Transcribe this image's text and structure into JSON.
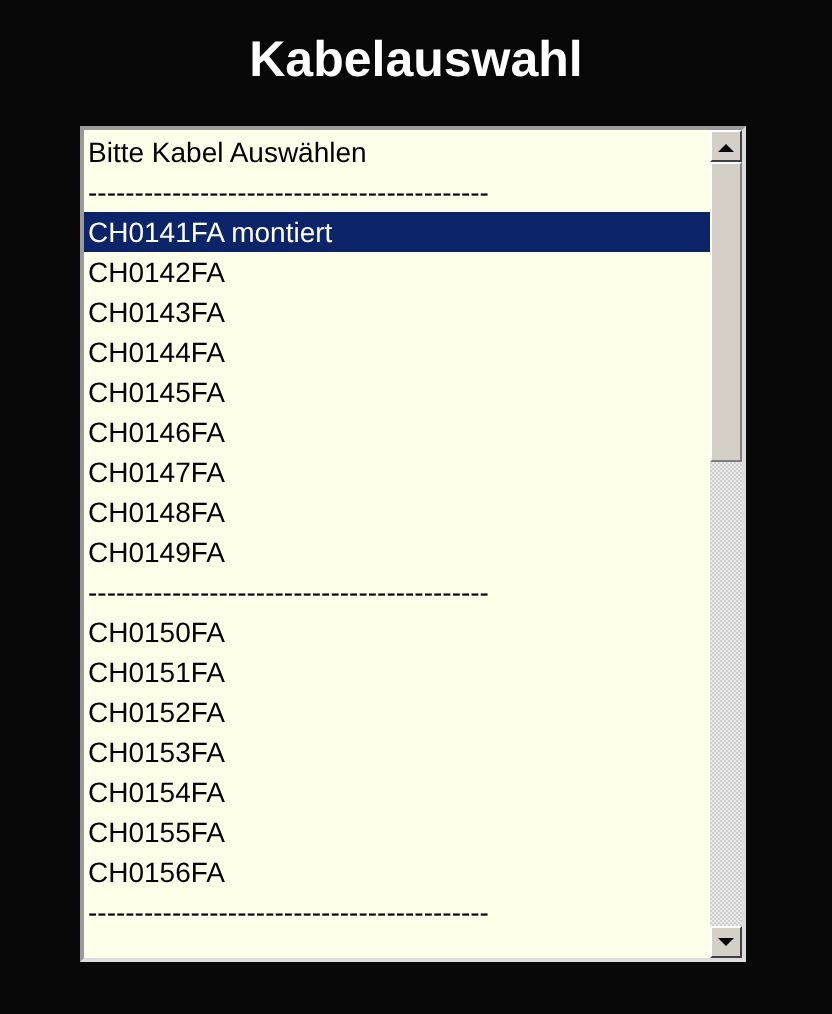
{
  "title": "Kabelauswahl",
  "list": {
    "items": [
      {
        "text": "Bitte Kabel Auswählen",
        "selected": false
      },
      {
        "text": "-------------------------------------------",
        "selected": false
      },
      {
        "text": "CH0141FA montiert",
        "selected": true
      },
      {
        "text": "CH0142FA",
        "selected": false
      },
      {
        "text": "CH0143FA",
        "selected": false
      },
      {
        "text": "CH0144FA",
        "selected": false
      },
      {
        "text": "CH0145FA",
        "selected": false
      },
      {
        "text": "CH0146FA",
        "selected": false
      },
      {
        "text": "CH0147FA",
        "selected": false
      },
      {
        "text": "CH0148FA",
        "selected": false
      },
      {
        "text": "CH0149FA",
        "selected": false
      },
      {
        "text": "-------------------------------------------",
        "selected": false
      },
      {
        "text": "CH0150FA",
        "selected": false
      },
      {
        "text": "CH0151FA",
        "selected": false
      },
      {
        "text": "CH0152FA",
        "selected": false
      },
      {
        "text": "CH0153FA",
        "selected": false
      },
      {
        "text": "CH0154FA",
        "selected": false
      },
      {
        "text": "CH0155FA",
        "selected": false
      },
      {
        "text": "CH0156FA",
        "selected": false
      },
      {
        "text": "-------------------------------------------",
        "selected": false
      }
    ]
  }
}
